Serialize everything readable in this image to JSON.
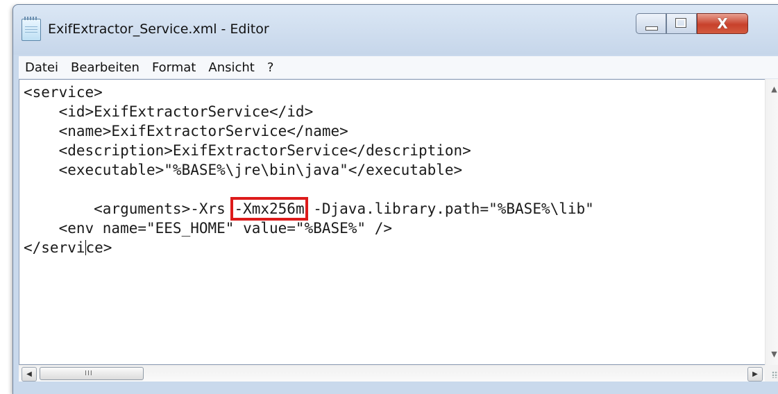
{
  "window": {
    "title": "ExifExtractor_Service.xml - Editor",
    "icon": "notepad-icon",
    "controls": {
      "minimize": "minimize-icon",
      "maximize": "maximize-icon",
      "close_glyph": "X"
    }
  },
  "menu": [
    "Datei",
    "Bearbeiten",
    "Format",
    "Ansicht",
    "?"
  ],
  "editor": {
    "lines": [
      "<service>",
      "    <id>ExifExtractorService</id>",
      "    <name>ExifExtractorService</name>",
      "    <description>ExifExtractorService</description>",
      "    <executable>\"%BASE%\\jre\\bin\\java\"</executable>",
      ""
    ],
    "arguments_before": "        <arguments>-Xrs ",
    "arguments_highlight": "-Xmx256m",
    "arguments_after": " -Djava.library.path=\"%BASE%\\lib\"",
    "env_line": "    <env name=\"EES_HOME\" value=\"%BASE%\" />",
    "closing_before_caret": "</servi",
    "closing_after_caret": "ce>",
    "highlight_color": "#dd1b1b"
  },
  "scrollbars": {
    "vertical": true,
    "horizontal": true,
    "thumb_grip": "III"
  }
}
